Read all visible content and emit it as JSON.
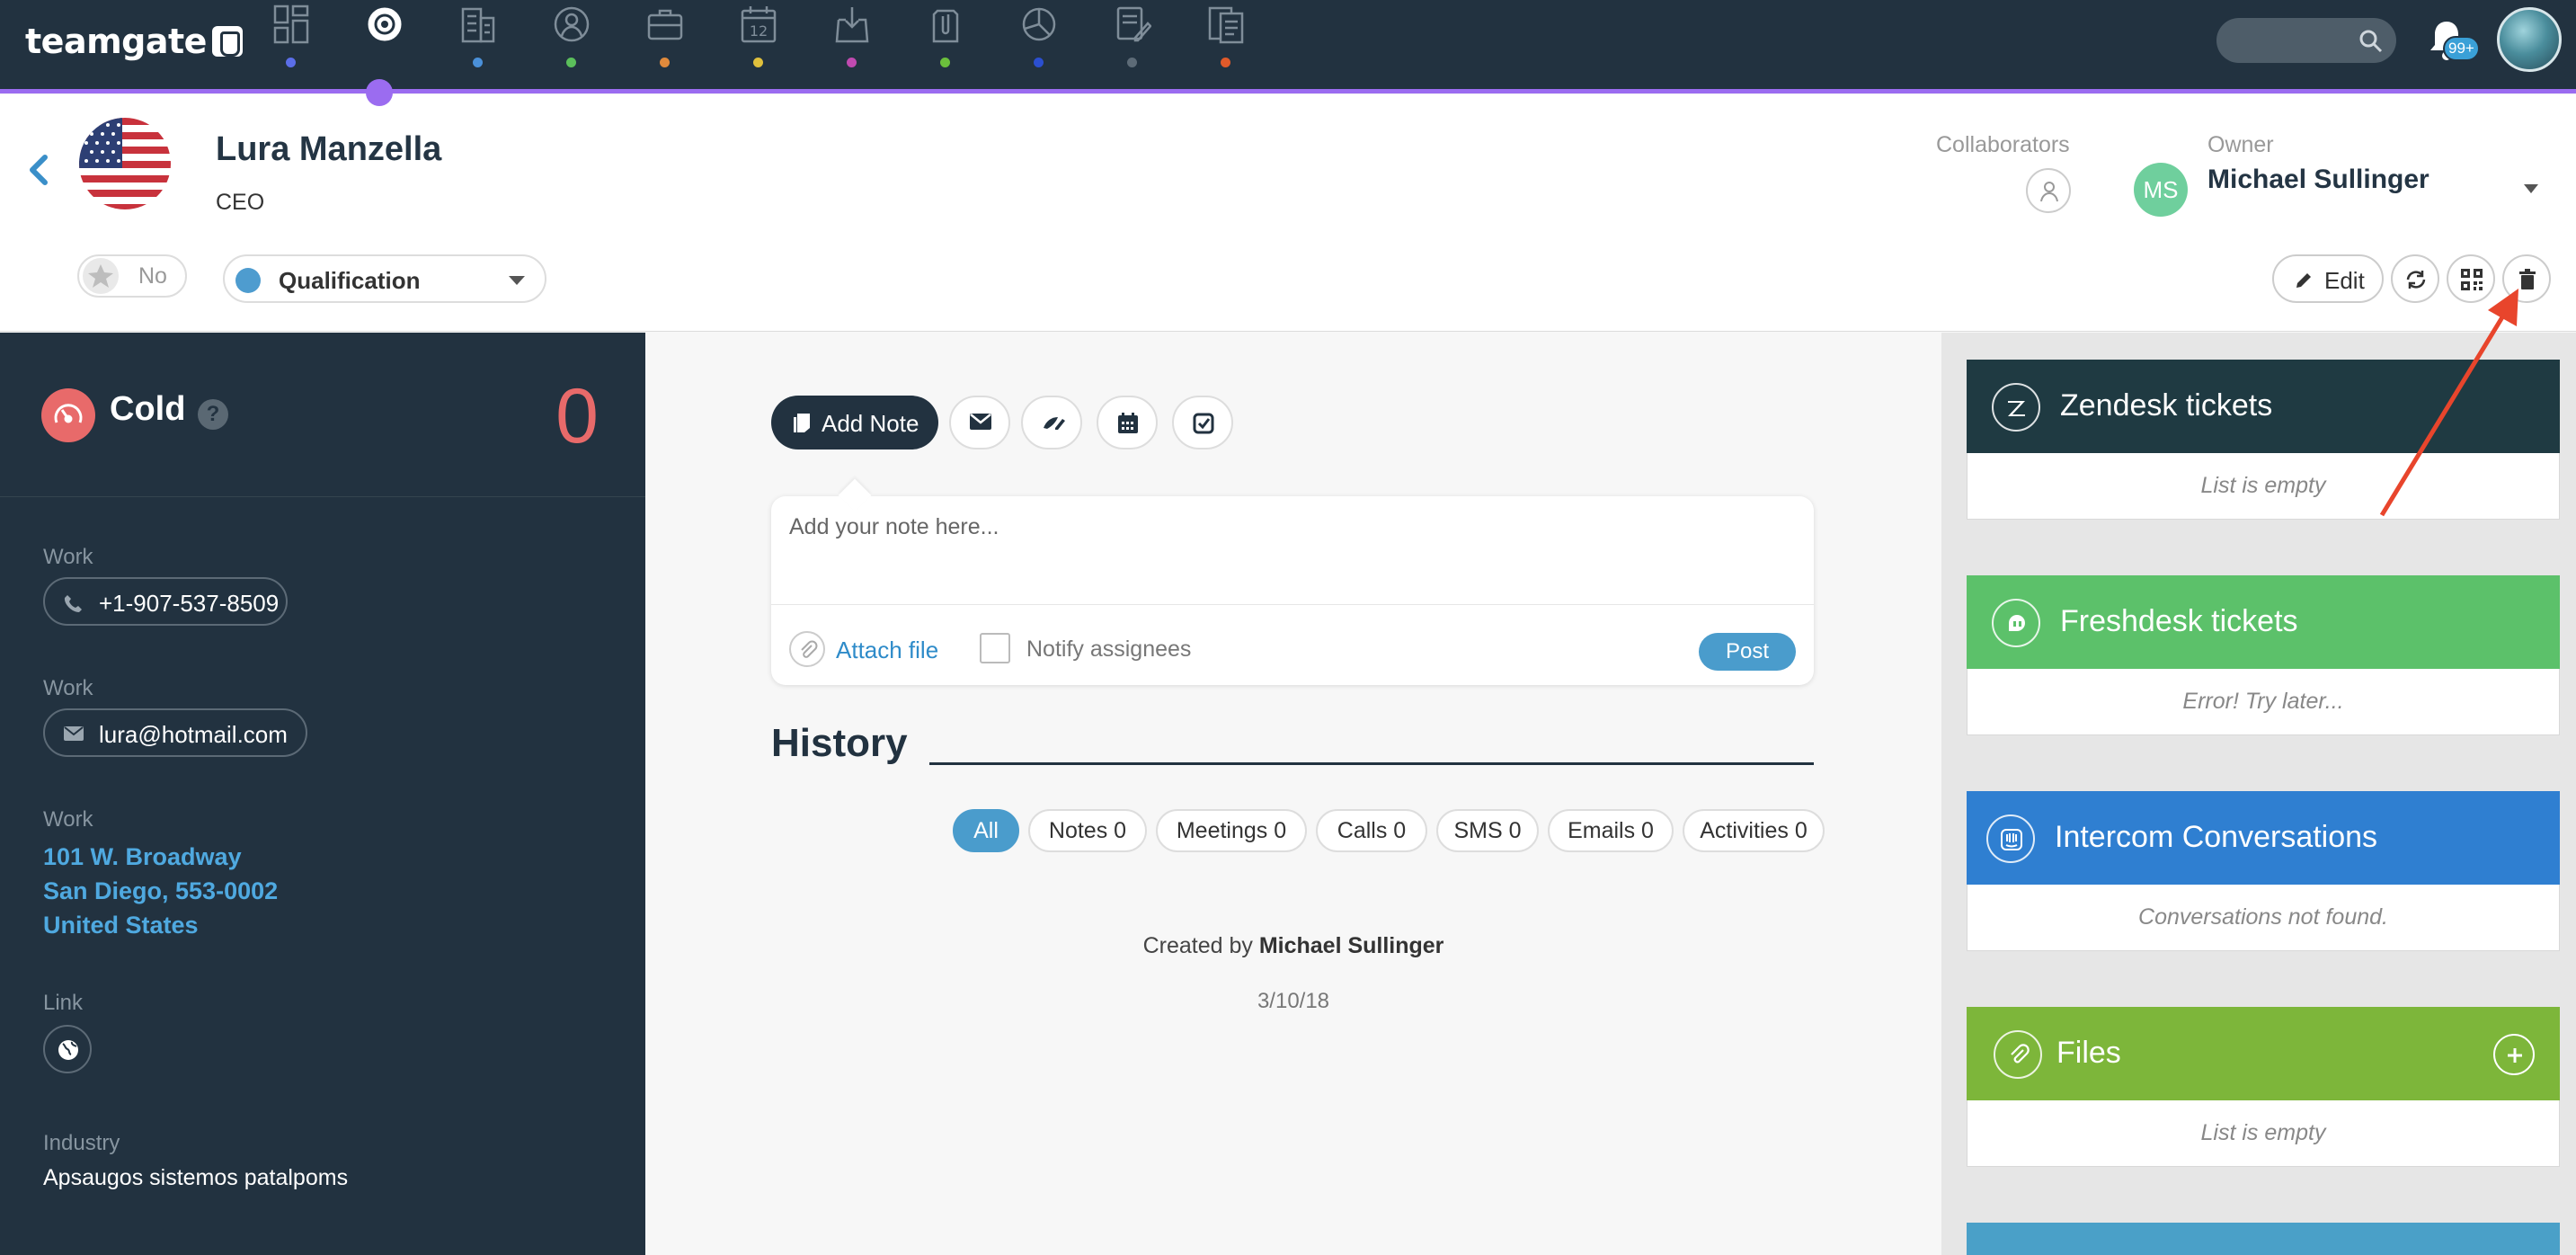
{
  "app": {
    "brand": "teamgate"
  },
  "topnav": {
    "items": [
      {
        "icon": "dashboard-icon",
        "dot_color": "#5b6ee8",
        "active": false
      },
      {
        "icon": "target-icon",
        "dot_color": "#9b6cf0",
        "active": true
      },
      {
        "icon": "companies-icon",
        "dot_color": "#4a90d9",
        "active": false
      },
      {
        "icon": "people-icon",
        "dot_color": "#5bbf5b",
        "active": false
      },
      {
        "icon": "deals-briefcase-icon",
        "dot_color": "#e08a3c",
        "active": false
      },
      {
        "icon": "calendar-icon",
        "dot_color": "#e0c03c",
        "active": false
      },
      {
        "icon": "inbox-icon",
        "dot_color": "#c04ab0",
        "active": false
      },
      {
        "icon": "files-icon",
        "dot_color": "#6bbf3c",
        "active": false
      },
      {
        "icon": "reports-pie-icon",
        "dot_color": "#2b4fd0",
        "active": false
      },
      {
        "icon": "notes-icon",
        "dot_color": "#5d6b77",
        "active": false
      },
      {
        "icon": "forms-icon",
        "dot_color": "#e05a2a",
        "active": false
      }
    ],
    "calendar_day": "12",
    "notification_badge": "99+"
  },
  "contact": {
    "name": "Lura Manzella",
    "title": "CEO",
    "star_value": "No",
    "stage": "Qualification",
    "stage_color": "#4e9ccf",
    "collaborators_label": "Collaborators",
    "owner_label": "Owner",
    "owner_initials": "MS",
    "owner_name": "Michael Sullinger"
  },
  "actions": {
    "edit_label": "Edit"
  },
  "sidebar": {
    "temperature": "Cold",
    "help": "?",
    "score": "0",
    "phone_label": "Work",
    "phone": "+1-907-537-8509",
    "email_label": "Work",
    "email": "lura@hotmail.com",
    "address_label": "Work",
    "address_lines": [
      "101 W. Broadway",
      "San Diego, 553-0002",
      "United States"
    ],
    "link_label": "Link",
    "industry_label": "Industry",
    "industry": "Apsaugos sistemos patalpoms"
  },
  "composer": {
    "add_note_label": "Add Note",
    "placeholder": "Add your note here...",
    "attach_label": "Attach file",
    "notify_label": "Notify assignees",
    "post_label": "Post"
  },
  "history": {
    "title": "History",
    "filters": [
      "All",
      "Notes 0",
      "Meetings 0",
      "Calls 0",
      "SMS 0",
      "Emails 0",
      "Activities 0"
    ],
    "active_filter": "All",
    "created_prefix": "Created by",
    "created_by": "Michael Sullinger",
    "created_date": "3/10/18"
  },
  "widgets": [
    {
      "title": "Zendesk tickets",
      "body": "List is empty",
      "color": "#1f3a42",
      "icon": "zendesk-icon"
    },
    {
      "title": "Freshdesk tickets",
      "body": "Error! Try later...",
      "color": "#5cc16a",
      "icon": "freshdesk-icon"
    },
    {
      "title": "Intercom Conversations",
      "body": "Conversations not found.",
      "color": "#2f7fd1",
      "icon": "intercom-icon"
    },
    {
      "title": "Files",
      "body": "List is empty",
      "color": "#7db63a",
      "icon": "paperclip-icon"
    }
  ]
}
